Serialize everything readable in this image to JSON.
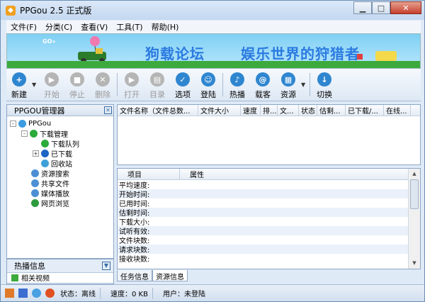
{
  "window": {
    "title": "PPGou 2.5 正式版"
  },
  "menu": [
    "文件(F)",
    "分类(C)",
    "查看(V)",
    "工具(T)",
    "帮助(H)"
  ],
  "banner": {
    "go": "GO»",
    "text1": "狗载论坛",
    "text2": "娱乐世界的狩猎者"
  },
  "toolbar": [
    {
      "label": "新建",
      "icon": "new-download-icon",
      "enabled": true,
      "color": "#2f86d0"
    },
    {
      "label": "开始",
      "icon": "play-icon",
      "enabled": false
    },
    {
      "label": "停止",
      "icon": "stop-icon",
      "enabled": false
    },
    {
      "label": "删除",
      "icon": "delete-icon",
      "enabled": false
    },
    {
      "label": "打开",
      "icon": "open-icon",
      "enabled": false
    },
    {
      "label": "目录",
      "icon": "folder-icon",
      "enabled": false
    },
    {
      "label": "选项",
      "icon": "options-icon",
      "enabled": true,
      "color": "#2f86d0"
    },
    {
      "label": "登陆",
      "icon": "login-icon",
      "enabled": true,
      "color": "#2f86d0"
    },
    {
      "label": "热播",
      "icon": "music-icon",
      "enabled": true,
      "color": "#2f86d0"
    },
    {
      "label": "载客",
      "icon": "swirl-icon",
      "enabled": true,
      "color": "#2f86d0"
    },
    {
      "label": "资源",
      "icon": "resource-icon",
      "enabled": true,
      "color": "#2f86d0"
    },
    {
      "label": "切换",
      "icon": "switch-icon",
      "enabled": true,
      "color": "#2f86d0"
    }
  ],
  "left_panel": {
    "title": "PPGOU管理器",
    "tree": [
      {
        "label": "PPGou",
        "box": "-",
        "color": "#3b9be0",
        "level": 0
      },
      {
        "label": "下载管理",
        "box": "-",
        "color": "#2bab3a",
        "level": 1
      },
      {
        "label": "下载队列",
        "box": "",
        "color": "#2bab3a",
        "level": 2
      },
      {
        "label": "已下载",
        "box": "+",
        "color": "#1c65c4",
        "level": 2
      },
      {
        "label": "回收站",
        "box": "",
        "color": "#3ea0d8",
        "level": 2
      },
      {
        "label": "资源搜索",
        "box": "",
        "color": "#4c8fd4",
        "level": 1
      },
      {
        "label": "共享文件",
        "box": "",
        "color": "#4c8fd4",
        "level": 1
      },
      {
        "label": "媒体播放",
        "box": "",
        "color": "#4c8fd4",
        "level": 1
      },
      {
        "label": "网页浏览",
        "box": "",
        "color": "#2e9b3f",
        "level": 1
      }
    ]
  },
  "hot": {
    "title": "热播信息",
    "item": "相关视频"
  },
  "task_table": {
    "columns": [
      "文件名称（文件总数...",
      "文件大小",
      "速度",
      "排...",
      "文...",
      "状态",
      "估剩...",
      "已下载/...",
      "在线..."
    ]
  },
  "props": {
    "headers": [
      "项目",
      "属性"
    ],
    "rows": [
      "平均速度:",
      "开始时间:",
      "已用时间:",
      "估剩时间:",
      "下载大小:",
      "试听有效:",
      "文件块数:",
      "请求块数:",
      "接收块数:"
    ]
  },
  "tabs": [
    "任务信息",
    "资源信息"
  ],
  "status": {
    "state": "状态：离线",
    "speed": "速度：0 KB",
    "user": "用户：未登陆"
  }
}
